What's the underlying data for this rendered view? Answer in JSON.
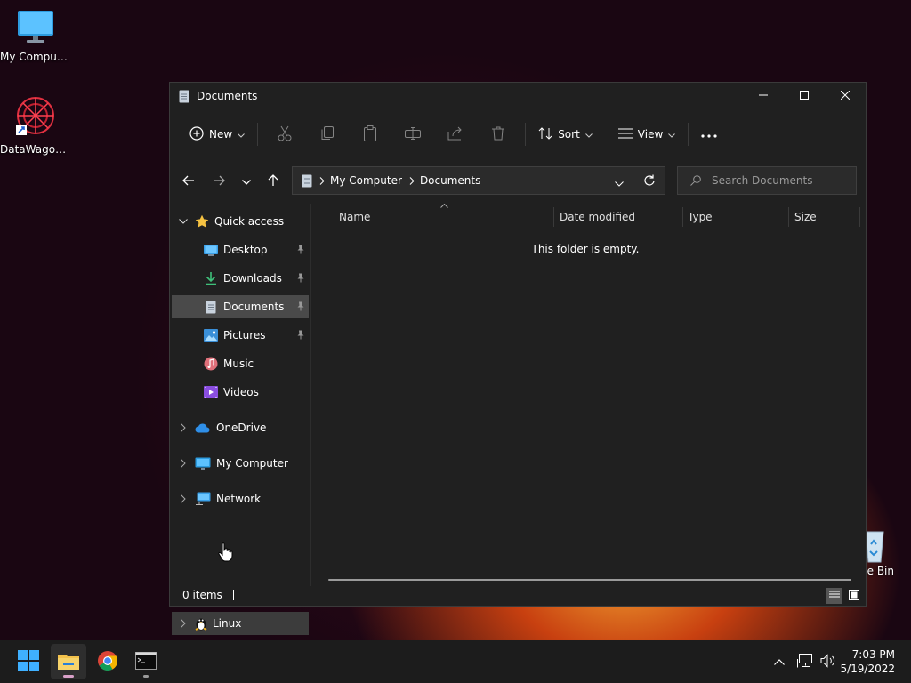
{
  "desktop": {
    "icons": [
      {
        "label": "My Computer",
        "icon": "monitor-icon"
      },
      {
        "label": "DataWagon...",
        "icon": "datawagon-app-icon"
      },
      {
        "label": "cle Bin",
        "icon": "recycle-bin-icon"
      }
    ]
  },
  "window": {
    "title": "Documents",
    "controls": [
      "minimize-icon",
      "maximize-icon",
      "close-icon"
    ]
  },
  "toolbar": {
    "new_label": "New",
    "sort_label": "Sort",
    "view_label": "View",
    "icons": [
      "cut-icon",
      "copy-icon",
      "paste-icon",
      "rename-icon",
      "share-icon",
      "delete-icon",
      "more-icon"
    ]
  },
  "address_bar": {
    "crumbs": [
      "My Computer",
      "Documents"
    ]
  },
  "search": {
    "placeholder": "Search Documents"
  },
  "sidebar": {
    "quick_access": "Quick access",
    "items": [
      {
        "label": "Desktop",
        "pinned": true
      },
      {
        "label": "Downloads",
        "pinned": true
      },
      {
        "label": "Documents",
        "pinned": true,
        "selected": true
      },
      {
        "label": "Pictures",
        "pinned": true
      },
      {
        "label": "Music",
        "pinned": false
      },
      {
        "label": "Videos",
        "pinned": false
      }
    ],
    "roots": [
      "OneDrive",
      "My Computer",
      "Network",
      "Linux"
    ]
  },
  "columns": [
    "Name",
    "Date modified",
    "Type",
    "Size"
  ],
  "empty_message": "This folder is empty.",
  "status": {
    "items": "0 items"
  },
  "taskbar": {
    "apps": [
      "start-icon",
      "file-explorer-icon",
      "chrome-icon",
      "terminal-icon"
    ],
    "tray_icons": [
      "chevron-up-icon",
      "network-icon",
      "volume-icon"
    ],
    "time": "7:03 PM",
    "date": "5/19/2022"
  },
  "colors": {
    "window_bg": "#202020",
    "selected_row": "#4a4a4a",
    "folder_yellow": "#f3c14b",
    "accent_blue": "#4aa8ff"
  }
}
